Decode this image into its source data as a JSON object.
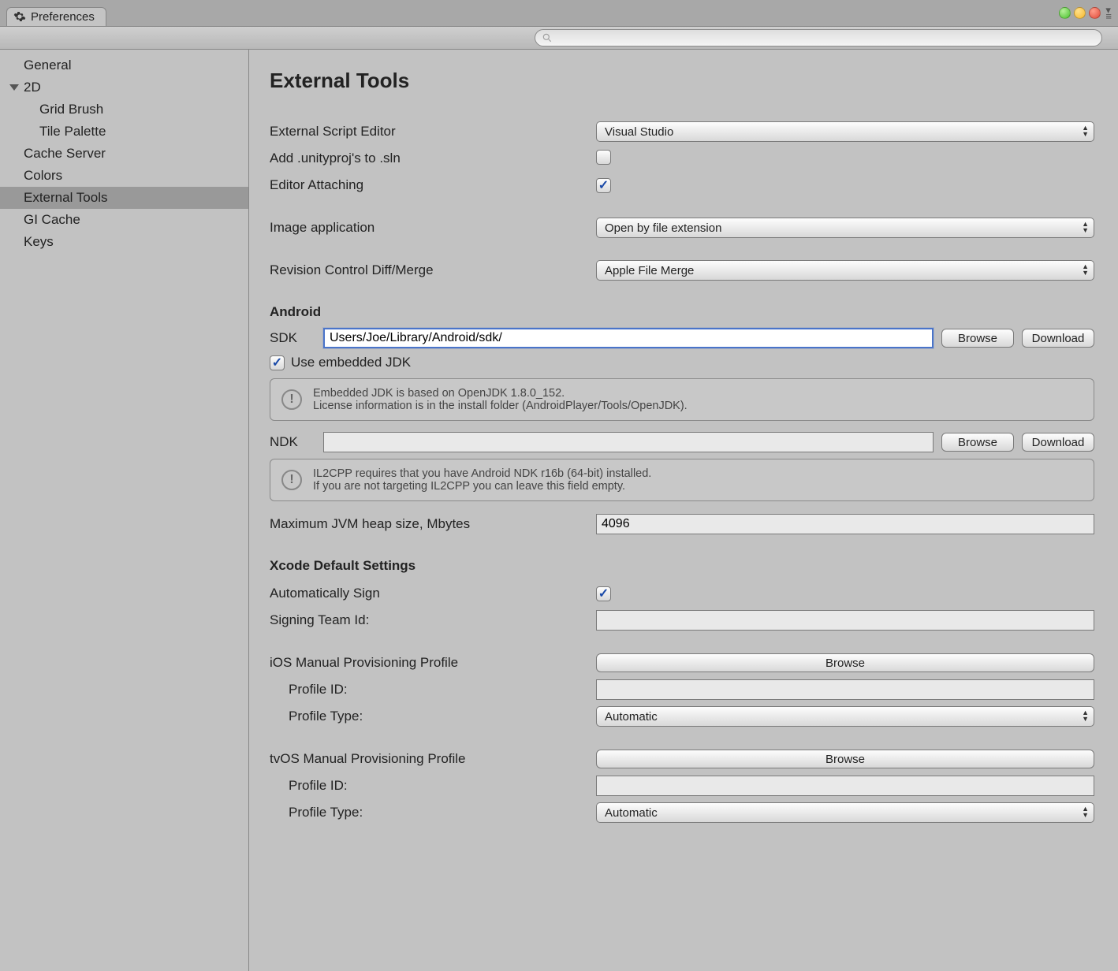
{
  "window": {
    "title": "Preferences"
  },
  "search": {
    "placeholder": ""
  },
  "sidebar": {
    "items": [
      {
        "label": "General"
      },
      {
        "label": "2D"
      },
      {
        "label": "Grid Brush"
      },
      {
        "label": "Tile Palette"
      },
      {
        "label": "Cache Server"
      },
      {
        "label": "Colors"
      },
      {
        "label": "External Tools"
      },
      {
        "label": "GI Cache"
      },
      {
        "label": "Keys"
      }
    ]
  },
  "page": {
    "title": "External Tools",
    "externalScriptEditor": {
      "label": "External Script Editor",
      "value": "Visual Studio"
    },
    "addUnityproj": {
      "label": "Add .unityproj's to .sln",
      "checked": false
    },
    "editorAttaching": {
      "label": "Editor Attaching",
      "checked": true
    },
    "imageApplication": {
      "label": "Image application",
      "value": "Open by file extension"
    },
    "revisionControl": {
      "label": "Revision Control Diff/Merge",
      "value": "Apple File Merge"
    },
    "android": {
      "heading": "Android",
      "sdk": {
        "label": "SDK",
        "value": "Users/Joe/Library/Android/sdk/",
        "browse": "Browse",
        "download": "Download"
      },
      "useEmbeddedJdk": {
        "label": "Use embedded JDK",
        "checked": true
      },
      "jdkInfo1": "Embedded JDK is based on OpenJDK 1.8.0_152.",
      "jdkInfo2": "License information is in the install folder (AndroidPlayer/Tools/OpenJDK).",
      "ndk": {
        "label": "NDK",
        "value": "",
        "browse": "Browse",
        "download": "Download"
      },
      "ndkInfo1": "IL2CPP requires that you have Android NDK r16b (64-bit) installed.",
      "ndkInfo2": "If you are not targeting IL2CPP you can leave this field empty.",
      "jvmHeap": {
        "label": "Maximum JVM heap size, Mbytes",
        "value": "4096"
      }
    },
    "xcode": {
      "heading": "Xcode Default Settings",
      "autoSign": {
        "label": "Automatically Sign",
        "checked": true
      },
      "signingTeam": {
        "label": "Signing Team Id:",
        "value": ""
      },
      "ios": {
        "heading": "iOS Manual Provisioning Profile",
        "browse": "Browse",
        "profileId": {
          "label": "Profile ID:",
          "value": ""
        },
        "profileType": {
          "label": "Profile Type:",
          "value": "Automatic"
        }
      },
      "tvos": {
        "heading": "tvOS Manual Provisioning Profile",
        "browse": "Browse",
        "profileId": {
          "label": "Profile ID:",
          "value": ""
        },
        "profileType": {
          "label": "Profile Type:",
          "value": "Automatic"
        }
      }
    }
  }
}
